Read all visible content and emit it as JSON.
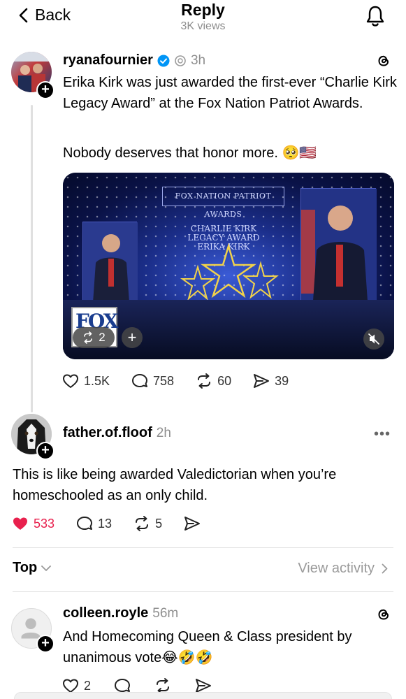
{
  "header": {
    "back_label": "Back",
    "title": "Reply",
    "views": "3K views"
  },
  "post": {
    "username": "ryanafournier",
    "time": "3h",
    "text1": "Erika Kirk was just awarded the first-ever “Charlie Kirk Legacy Award” at the Fox Nation Patriot Awards.",
    "text2": "Nobody deserves that honor more. 🥺🇺🇸",
    "video": {
      "sign_text": "FOX NATION PATRIOT AWARDS",
      "award_text": "CHARLIE KIRK LEGACY AWARD ERIKA KIRK",
      "logo_text": "FOX",
      "repost_count": "2",
      "add_symbol": "+"
    },
    "likes": "1.5K",
    "replies": "758",
    "reposts": "60",
    "shares": "39"
  },
  "reply": {
    "username": "father.of.floof",
    "time": "2h",
    "text": "This is like being awarded Valedictorian when you’re homeschooled as an only child.",
    "likes": "533",
    "replies": "13",
    "reposts": "5",
    "more": "•••"
  },
  "sort": {
    "label": "Top",
    "view_activity": "View activity"
  },
  "comment": {
    "username": "colleen.royle",
    "time": "56m",
    "text": "And Homecoming Queen & Class president by unanimous vote😂🤣🤣",
    "likes": "2"
  },
  "plus_symbol": "+",
  "colors": {
    "like_active": "#e8204d",
    "muted_text": "#8e8e8e",
    "verified": "#0095f6"
  }
}
